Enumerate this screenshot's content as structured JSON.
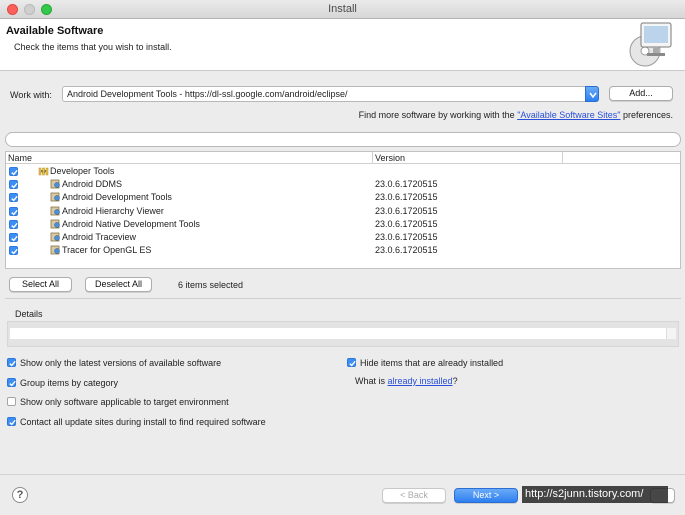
{
  "window": {
    "title": "Install"
  },
  "header": {
    "title": "Available Software",
    "description": "Check the items that you wish to install."
  },
  "work_with": {
    "label": "Work with:",
    "value": "Android Development Tools - https://dl-ssl.google.com/android/eclipse/",
    "add_label": "Add..."
  },
  "find_more": {
    "prefix": "Find more software by working with the ",
    "link": "\"Available Software Sites\"",
    "suffix": " preferences."
  },
  "filter": {
    "value": ""
  },
  "table": {
    "columns": [
      "Name",
      "Version"
    ],
    "category": {
      "name": "Developer Tools",
      "checked": true
    },
    "rows": [
      {
        "name": "Android DDMS",
        "version": "23.0.6.1720515",
        "checked": true
      },
      {
        "name": "Android Development Tools",
        "version": "23.0.6.1720515",
        "checked": true
      },
      {
        "name": "Android Hierarchy Viewer",
        "version": "23.0.6.1720515",
        "checked": true
      },
      {
        "name": "Android Native Development Tools",
        "version": "23.0.6.1720515",
        "checked": true
      },
      {
        "name": "Android Traceview",
        "version": "23.0.6.1720515",
        "checked": true
      },
      {
        "name": "Tracer for OpenGL ES",
        "version": "23.0.6.1720515",
        "checked": true
      }
    ]
  },
  "selection": {
    "select_all": "Select All",
    "deselect_all": "Deselect All",
    "count": "6 items selected"
  },
  "details": {
    "label": "Details"
  },
  "options": {
    "latest_versions": {
      "label": "Show only the latest versions of available software",
      "checked": true
    },
    "group_by_category": {
      "label": "Group items by category",
      "checked": true
    },
    "target_env": {
      "label": "Show only software applicable to target environment",
      "checked": false
    },
    "contact_sites": {
      "label": "Contact all update sites during install to find required software",
      "checked": true
    },
    "hide_installed": {
      "label": "Hide items that are already installed",
      "checked": true
    },
    "what_is": {
      "prefix": "What is ",
      "link": "already installed",
      "suffix": "?"
    }
  },
  "footer": {
    "help": "?",
    "back": "< Back",
    "next": "Next >",
    "watermark": "http://s2junn.tistory.com/"
  },
  "colors": {
    "accent": "#3d8ff3",
    "link": "#2b4fd8"
  }
}
